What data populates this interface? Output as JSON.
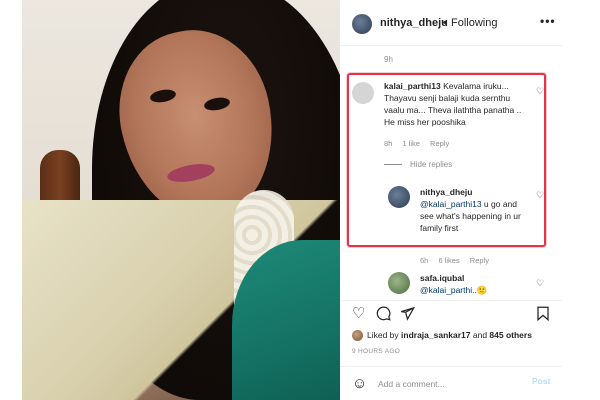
{
  "post": {
    "username": "nithya_dheju",
    "dot": "•",
    "follow_status": "Following",
    "more_icon": "more-dots-icon"
  },
  "caption": {
    "time": "9h"
  },
  "comments": [
    {
      "username": "kalai_parthi13",
      "text": "Kevalama iruku... Thayavu senji balaji kuda sernthu vaalu ma... Theva ilaththa panatha .. He miss her pooshika",
      "time": "8h",
      "likes": "1 like",
      "reply": "Reply",
      "hide_replies": "Hide replies",
      "replies": [
        {
          "username": "nithya_dheju",
          "mention": "@kalai_parthi13",
          "text": " u go and see what's happening in ur family first",
          "time": "6h",
          "likes": "6 likes",
          "reply": "Reply"
        }
      ]
    },
    {
      "username": "safa.iqubal",
      "mention": "@kalai_parthi..",
      "trail": "🙂"
    }
  ],
  "actions": {
    "like_icon": "heart-icon",
    "comment_icon": "comment-icon",
    "share_icon": "share-icon",
    "save_icon": "bookmark-icon"
  },
  "likes": {
    "prefix": "Liked by ",
    "user": "indraja_sankar17",
    "middle": " and ",
    "count": "845 others"
  },
  "posted_ago": "9 HOURS AGO",
  "add_comment": {
    "placeholder": "Add a comment...",
    "post_label": "Post"
  },
  "colors": {
    "highlight": "#e3334b",
    "mention": "#00376b",
    "post_disabled": "#b2dffc"
  }
}
